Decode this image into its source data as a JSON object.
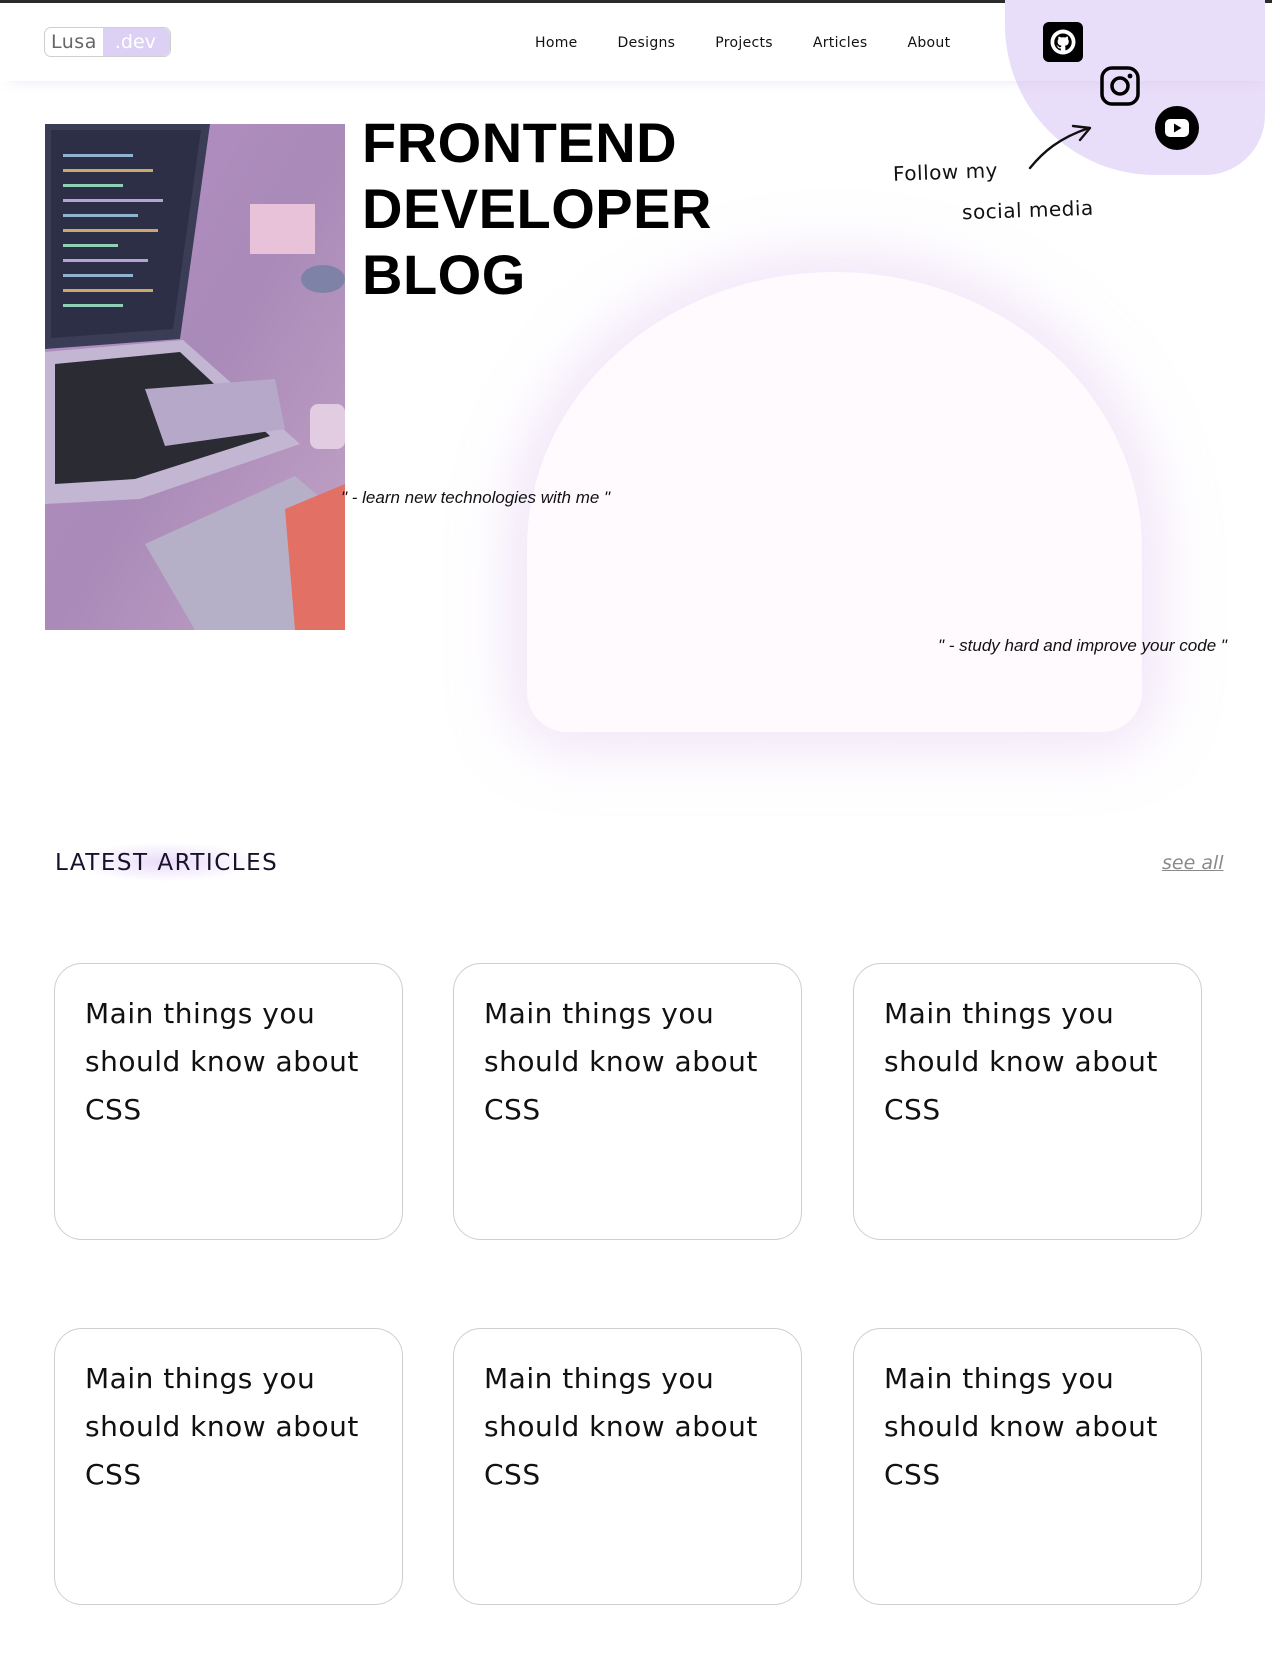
{
  "logo": {
    "name": "Lusa",
    "tag": ".dev"
  },
  "nav": {
    "items": [
      {
        "label": "Home"
      },
      {
        "label": "Designs"
      },
      {
        "label": "Projects"
      },
      {
        "label": "Articles"
      },
      {
        "label": "About"
      }
    ]
  },
  "social": {
    "icons": [
      "github-icon",
      "instagram-icon",
      "youtube-icon"
    ],
    "follow_line1": "Follow my",
    "follow_line2": "social media"
  },
  "hero": {
    "title": "FRONTEND DEVELOPER BLOG",
    "quote_left": "\" - learn new technologies with me \"",
    "quote_right": "\" - study hard and improve your code \""
  },
  "articles": {
    "heading": "LATEST ARTICLES",
    "see_all": "see all",
    "cards": [
      {
        "title": "Main things you should know about CSS"
      },
      {
        "title": "Main things you should know about CSS"
      },
      {
        "title": "Main things you should know about CSS"
      },
      {
        "title": "Main things you should know about CSS"
      },
      {
        "title": "Main things you should know about CSS"
      },
      {
        "title": "Main things you should know about CSS"
      }
    ]
  },
  "colors": {
    "accent_lavender": "#e9def9",
    "logo_tag_bg": "#dcd0f5",
    "text": "#111111",
    "card_border": "#cfcfcf"
  }
}
